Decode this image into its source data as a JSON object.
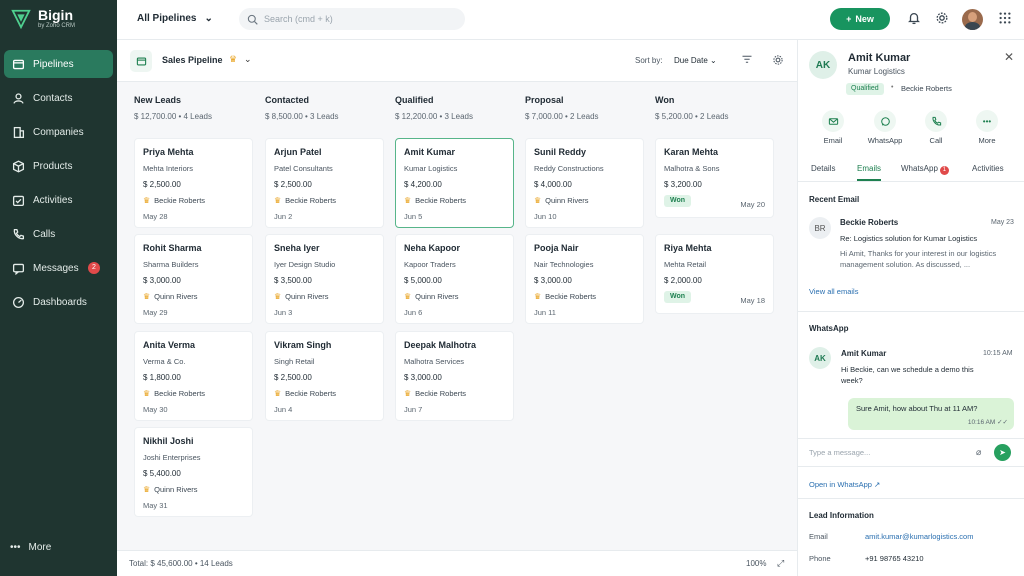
{
  "app": {
    "name": "Bigin",
    "sub": "by Zoho CRM"
  },
  "sidebar": {
    "items": [
      {
        "label": "Pipelines"
      },
      {
        "label": "Contacts"
      },
      {
        "label": "Companies"
      },
      {
        "label": "Products"
      },
      {
        "label": "Activities"
      },
      {
        "label": "Calls"
      },
      {
        "label": "Messages",
        "badge": "2"
      },
      {
        "label": "Dashboards"
      }
    ],
    "more_label": "More"
  },
  "topbar": {
    "pipeline_select": "All Pipelines",
    "search_placeholder": "Search (cmd + k)",
    "new_label": "New"
  },
  "board": {
    "pipeline_name": "Sales Pipeline",
    "sort_label": "Sort by:",
    "sort_value": "Due Date",
    "columns": [
      {
        "title": "New Leads",
        "summary": "$ 12,700.00  •  4 Leads",
        "cards": [
          {
            "name": "Priya Mehta",
            "company": "Mehta Interiors",
            "amount": "$ 2,500.00",
            "owner": "Beckie Roberts",
            "date": "May 28"
          },
          {
            "name": "Rohit Sharma",
            "company": "Sharma Builders",
            "amount": "$ 3,000.00",
            "owner": "Quinn Rivers",
            "date": "May 29"
          },
          {
            "name": "Anita Verma",
            "company": "Verma & Co.",
            "amount": "$ 1,800.00",
            "owner": "Beckie Roberts",
            "date": "May 30"
          },
          {
            "name": "Nikhil Joshi",
            "company": "Joshi Enterprises",
            "amount": "$ 5,400.00",
            "owner": "Quinn Rivers",
            "date": "May 31"
          }
        ]
      },
      {
        "title": "Contacted",
        "summary": "$ 8,500.00  •  3 Leads",
        "cards": [
          {
            "name": "Arjun Patel",
            "company": "Patel Consultants",
            "amount": "$ 2,500.00",
            "owner": "Beckie Roberts",
            "date": "Jun 2"
          },
          {
            "name": "Sneha Iyer",
            "company": "Iyer Design Studio",
            "amount": "$ 3,500.00",
            "owner": "Quinn Rivers",
            "date": "Jun 3"
          },
          {
            "name": "Vikram Singh",
            "company": "Singh Retail",
            "amount": "$ 2,500.00",
            "owner": "Beckie Roberts",
            "date": "Jun 4"
          }
        ]
      },
      {
        "title": "Qualified",
        "summary": "$ 12,200.00  •  3 Leads",
        "cards": [
          {
            "name": "Amit Kumar",
            "company": "Kumar Logistics",
            "amount": "$ 4,200.00",
            "owner": "Beckie Roberts",
            "date": "Jun 5"
          },
          {
            "name": "Neha Kapoor",
            "company": "Kapoor Traders",
            "amount": "$ 5,000.00",
            "owner": "Quinn Rivers",
            "date": "Jun 6"
          },
          {
            "name": "Deepak Malhotra",
            "company": "Malhotra Services",
            "amount": "$ 3,000.00",
            "owner": "Beckie Roberts",
            "date": "Jun 7"
          }
        ]
      },
      {
        "title": "Proposal",
        "summary": "$ 7,000.00  •  2 Leads",
        "cards": [
          {
            "name": "Sunil Reddy",
            "company": "Reddy Constructions",
            "amount": "$ 4,000.00",
            "owner": "Quinn Rivers",
            "date": "Jun 10"
          },
          {
            "name": "Pooja Nair",
            "company": "Nair Technologies",
            "amount": "$ 3,000.00",
            "owner": "Beckie Roberts",
            "date": "Jun 11"
          }
        ]
      },
      {
        "title": "Won",
        "summary": "$ 5,200.00  •  2 Leads",
        "cards": [
          {
            "name": "Karan Mehta",
            "company": "Malhotra & Sons",
            "amount": "$ 3,200.00",
            "badge": "Won",
            "date": "May 20"
          },
          {
            "name": "Riya Mehta",
            "company": "Mehta Retail",
            "amount": "$ 2,000.00",
            "badge": "Won",
            "date": "May 18"
          }
        ]
      }
    ],
    "footer_total": "Total: $ 45,600.00  •  14 Leads",
    "zoom": "100%"
  },
  "panel": {
    "initials": "AK",
    "name": "Amit Kumar",
    "company": "Kumar Logistics",
    "status": "Qualified",
    "owner": "Beckie Roberts",
    "actions": [
      "Email",
      "WhatsApp",
      "Call",
      "More"
    ],
    "tabs": [
      "Details",
      "Emails",
      "WhatsApp",
      "Activities"
    ],
    "whatsapp_badge": "1",
    "recent_email_title": "Recent Email",
    "email": {
      "initials": "BR",
      "from": "Beckie Roberts",
      "date": "May 23",
      "subject": "Re: Logistics solution for Kumar Logistics",
      "body": "Hi Amit, Thanks for your interest in our logistics management solution. As discussed, ..."
    },
    "view_all_emails": "View all emails",
    "whatsapp_title": "WhatsApp",
    "wa": {
      "initials": "AK",
      "name": "Amit Kumar",
      "time1": "10:15 AM",
      "msg1": "Hi Beckie, can we schedule a demo this week?",
      "reply": "Sure Amit, how about Thu at 11 AM?",
      "reply_time": "10:16 AM ✓✓",
      "input_placeholder": "Type a message..."
    },
    "open_whatsapp": "Open in WhatsApp",
    "lead_info_title": "Lead Information",
    "info": [
      {
        "key": "Email",
        "value": "amit.kumar@kumarlogistics.com",
        "link": true
      },
      {
        "key": "Phone",
        "value": "+91 98765 43210",
        "link": false
      }
    ]
  }
}
